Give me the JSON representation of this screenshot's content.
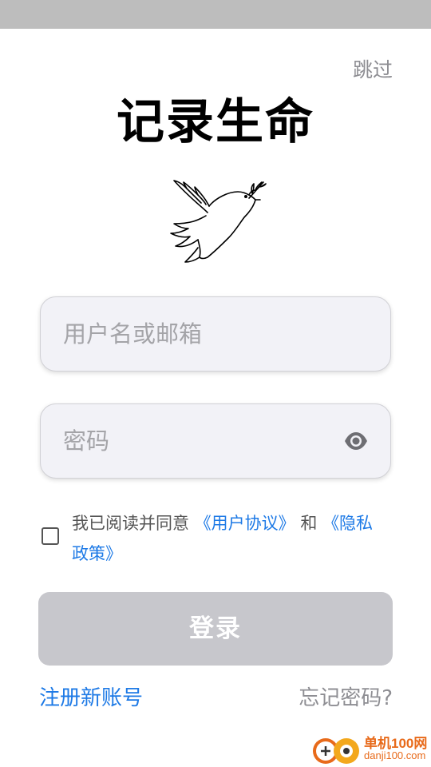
{
  "header": {
    "skip_label": "跳过"
  },
  "title": "记录生命",
  "logo": {
    "icon": "dove-with-olive-branch-icon"
  },
  "form": {
    "username_placeholder": "用户名或邮箱",
    "password_placeholder": "密码",
    "password_toggle_icon": "eye-icon"
  },
  "agreement": {
    "checked": false,
    "prefix": "我已阅读并同意",
    "user_agreement": "《用户协议》",
    "conjunction": "和",
    "privacy_policy": "《隐私政策》"
  },
  "login_button": "登录",
  "footer": {
    "register": "注册新账号",
    "forgot": "忘记密码?"
  },
  "watermark": {
    "line1": "单机100网",
    "line2": "danji100.com"
  },
  "colors": {
    "status_bar": "#bdbdbd",
    "link": "#1e7ae6",
    "muted": "#8e8e93",
    "field_bg": "#f2f2f7",
    "button_disabled": "#c7c7cc",
    "watermark": "#e86a1a"
  }
}
